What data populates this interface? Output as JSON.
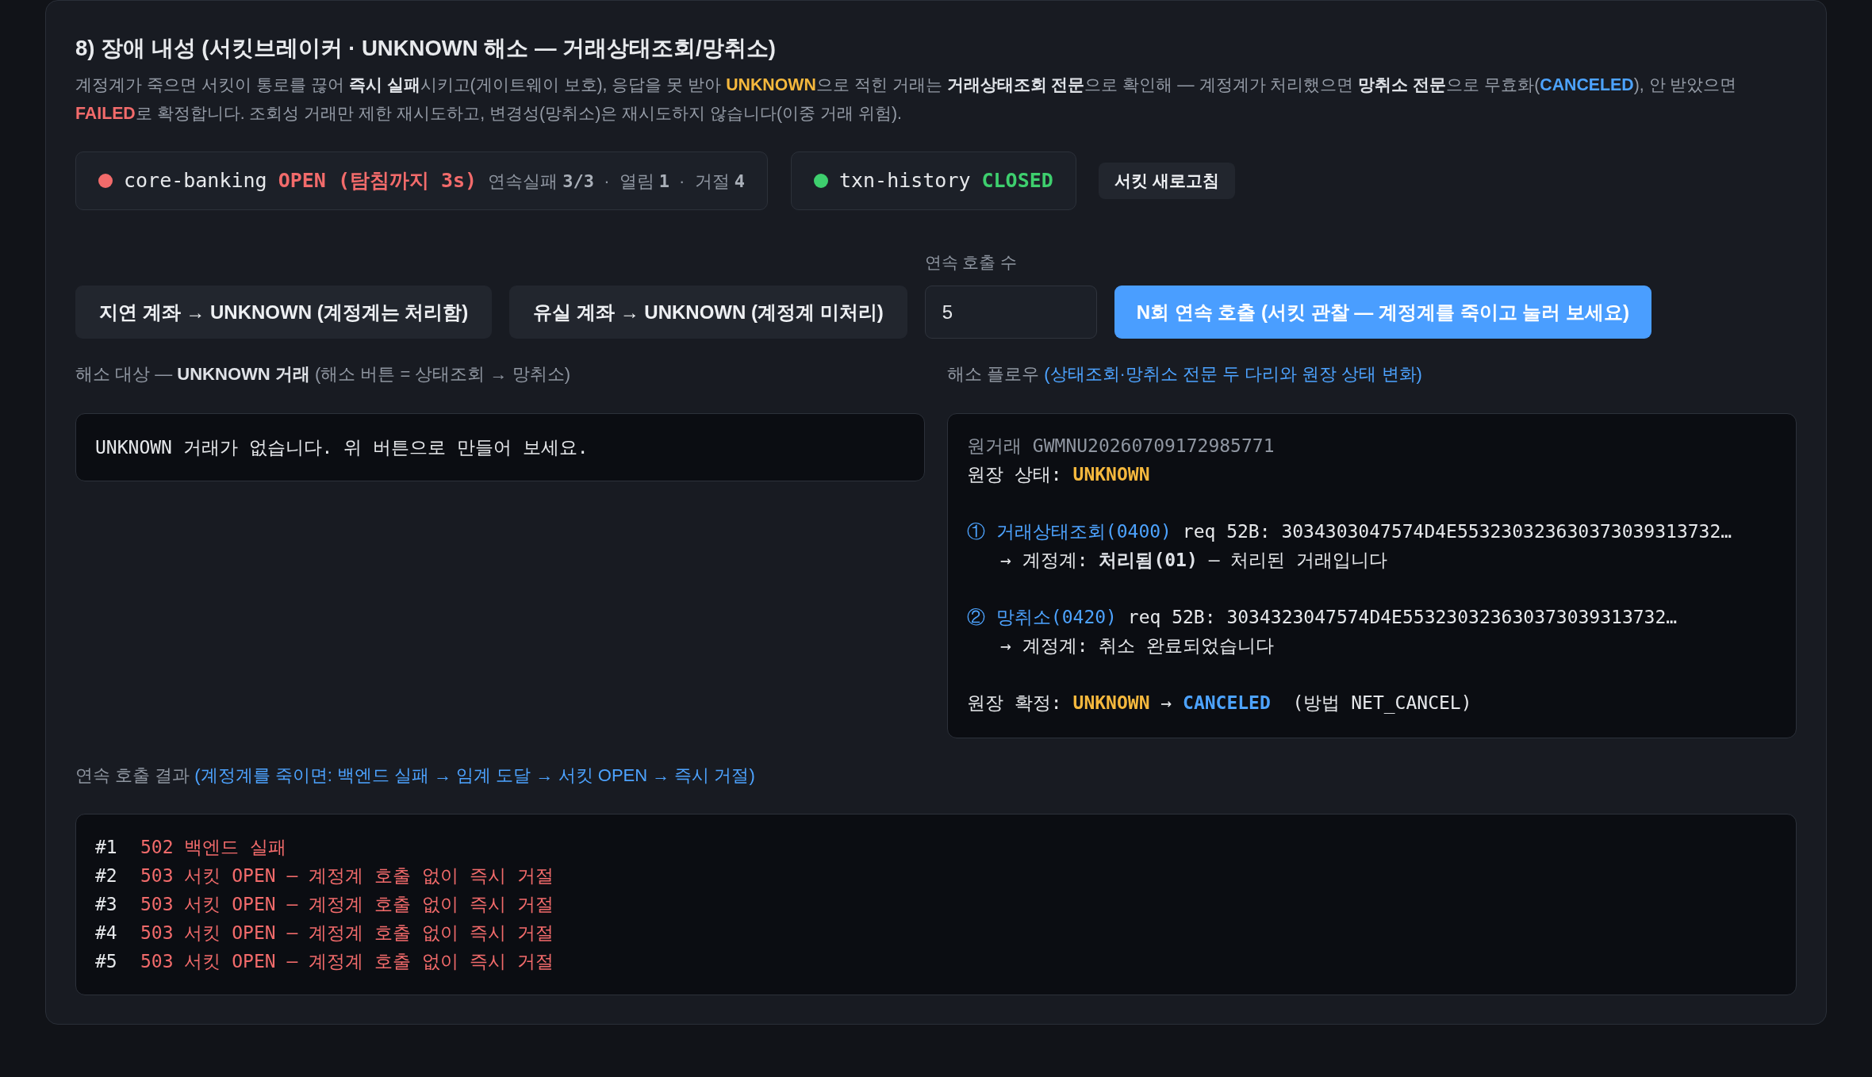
{
  "section": {
    "title": "8) 장애 내성 (서킷브레이커 · UNKNOWN 해소 — 거래상태조회/망취소)",
    "description": [
      {
        "text": "계정계가 죽으면 서킷이 통로를 끊어 ",
        "kind": "plain"
      },
      {
        "text": "즉시 실패",
        "kind": "bold"
      },
      {
        "text": "시키고(게이트웨이 보호), 응답을 못 받아 ",
        "kind": "plain"
      },
      {
        "text": "UNKNOWN",
        "kind": "warning"
      },
      {
        "text": "으로 적힌 거래는 ",
        "kind": "plain"
      },
      {
        "text": "거래상태조회 전문",
        "kind": "bold"
      },
      {
        "text": "으로 확인해 — 계정계가 처리했으면 ",
        "kind": "plain"
      },
      {
        "text": "망취소 전문",
        "kind": "bold"
      },
      {
        "text": "으로 무효화(",
        "kind": "plain"
      },
      {
        "text": "CANCELED",
        "kind": "highlight"
      },
      {
        "text": "), 안 받았으면 ",
        "kind": "plain"
      },
      {
        "text": "FAILED",
        "kind": "danger"
      },
      {
        "text": "로 확정합니다. 조회성 거래만 제한 재시도하고, 변경성(망취소)은 재시도하지 않습니다(이중 거래 위험).",
        "kind": "plain"
      }
    ]
  },
  "circuits": [
    {
      "name": "core-banking",
      "state": "OPEN (탐침까지 3s)",
      "color": "#f26b6b",
      "stats": [
        {
          "text": "연속실패",
          "kind": "label"
        },
        {
          "text": "3/3",
          "kind": "value"
        },
        {
          "text": "·",
          "kind": "sep"
        },
        {
          "text": "열림",
          "kind": "label"
        },
        {
          "text": "1",
          "kind": "value"
        },
        {
          "text": "·",
          "kind": "sep"
        },
        {
          "text": "거절",
          "kind": "label"
        },
        {
          "text": "4",
          "kind": "value"
        }
      ]
    },
    {
      "name": "txn-history",
      "state": "CLOSED",
      "color": "#3ecf6e"
    }
  ],
  "refresh_button": "서킷 새로고침",
  "actions": {
    "buttons": [
      {
        "label": "지연 계좌 → UNKNOWN (계정계는 처리함)",
        "kind": "secondary"
      },
      {
        "label": "유실 계좌 → UNKNOWN (계정계 미처리)",
        "kind": "secondary"
      }
    ],
    "count_field": {
      "label": "연속 호출 수",
      "value": "5"
    },
    "run_button": {
      "label": "N회 연속 호출 (서킷 관찰 — 계정계를 죽이고 눌러 보세요)",
      "kind": "primary"
    }
  },
  "resolve_target": {
    "heading": [
      {
        "text": "해소 대상 — ",
        "kind": "plain"
      },
      {
        "text": "UNKNOWN 거래",
        "kind": "bold"
      },
      {
        "text": " (해소 버튼 = 상태조회 → 망취소)",
        "kind": "plain"
      }
    ],
    "empty_message": "UNKNOWN 거래가 없습니다. 위 버튼으로 만들어 보세요."
  },
  "resolve_flow": {
    "heading": [
      {
        "text": "해소 플로우 ",
        "kind": "plain"
      },
      {
        "text": "(상태조회·망취소 전문 두 다리와 원장 상태 변화)",
        "kind": "info"
      }
    ],
    "groups": [
      {
        "lines": [
          {
            "segments": [
              {
                "text": "원거래 GWMNU20260709172985771",
                "kind": "muted"
              }
            ]
          },
          {
            "segments": [
              {
                "text": "원장 상태: ",
                "kind": "plain"
              },
              {
                "text": "UNKNOWN",
                "kind": "warning"
              }
            ]
          }
        ]
      },
      {
        "lines": [
          {
            "segments": [
              {
                "text": "① 거래상태조회(0400)",
                "kind": "info"
              },
              {
                "text": " req 52B: 3034303047574D4E553230323630373039313732…",
                "kind": "plain"
              }
            ],
            "children": [
              {
                "segments": [
                  {
                    "text": "→ 계정계: ",
                    "kind": "plain"
                  },
                  {
                    "text": "처리됨(01)",
                    "kind": "bold"
                  },
                  {
                    "text": " — 처리된 거래입니다",
                    "kind": "plain"
                  }
                ]
              }
            ]
          }
        ]
      },
      {
        "lines": [
          {
            "segments": [
              {
                "text": "② 망취소(0420)",
                "kind": "info"
              },
              {
                "text": " req 52B: 3034323047574D4E553230323630373039313732…",
                "kind": "plain"
              }
            ],
            "children": [
              {
                "segments": [
                  {
                    "text": "→ 계정계: 취소 완료되었습니다",
                    "kind": "plain"
                  }
                ]
              }
            ]
          }
        ]
      },
      {
        "lines": [
          {
            "segments": [
              {
                "text": "원장 확정: ",
                "kind": "plain"
              },
              {
                "text": "UNKNOWN",
                "kind": "warning"
              },
              {
                "text": " → ",
                "kind": "plain"
              },
              {
                "text": "CANCELED",
                "kind": "highlight"
              },
              {
                "text": "  (방법 NET_CANCEL)",
                "kind": "plain"
              }
            ]
          }
        ]
      }
    ]
  },
  "burst_results": {
    "heading": [
      {
        "text": "연속 호출 결과 ",
        "kind": "plain"
      },
      {
        "text": "(계정계를 죽이면: 백엔드 실패 → 임계 도달 → 서킷 OPEN → 즉시 거절)",
        "kind": "info"
      }
    ],
    "rows": [
      {
        "index": "#1",
        "message": "502 백엔드 실패",
        "ok": false
      },
      {
        "index": "#2",
        "message": "503 서킷 OPEN — 계정계 호출 없이 즉시 거절",
        "ok": false
      },
      {
        "index": "#3",
        "message": "503 서킷 OPEN — 계정계 호출 없이 즉시 거절",
        "ok": false
      },
      {
        "index": "#4",
        "message": "503 서킷 OPEN — 계정계 호출 없이 즉시 거절",
        "ok": false
      },
      {
        "index": "#5",
        "message": "503 서킷 OPEN — 계정계 호출 없이 즉시 거절",
        "ok": false
      }
    ]
  }
}
